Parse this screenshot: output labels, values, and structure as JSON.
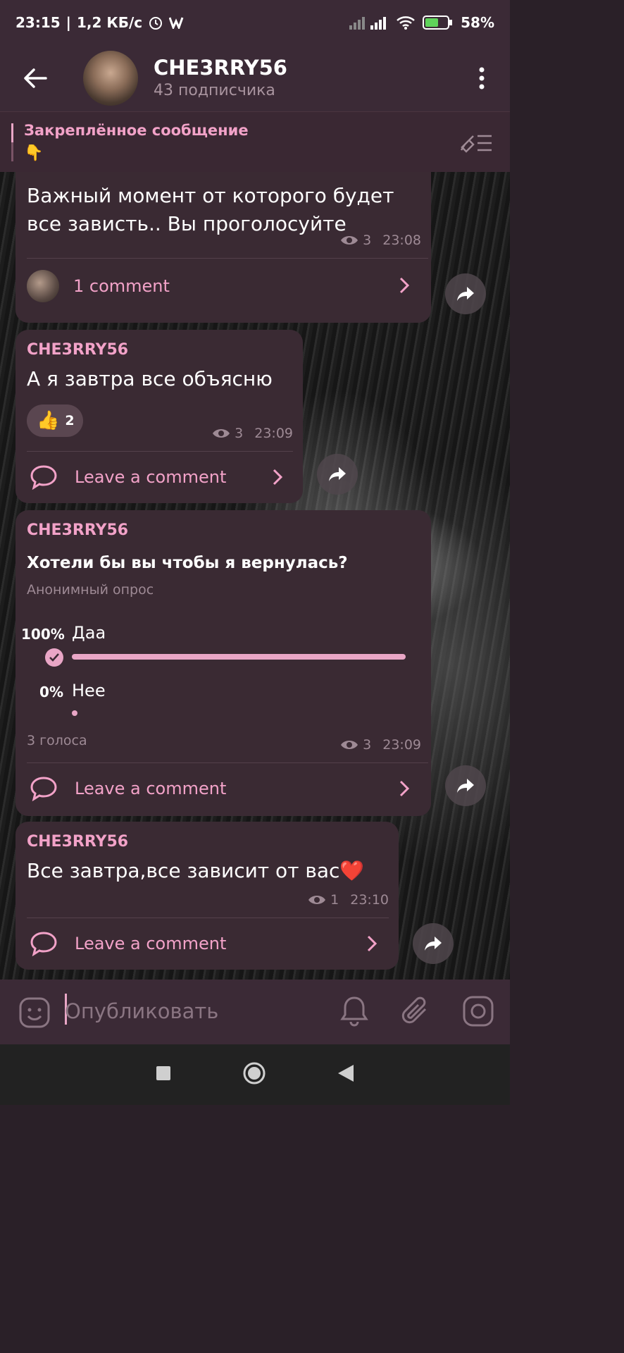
{
  "status": {
    "time": "23:15",
    "speed": "1,2 КБ/с",
    "battery": "58%"
  },
  "header": {
    "channel": "CHE3RRY56",
    "subscribers": "43 подписчика"
  },
  "pinned": {
    "title": "Закреплённое сообщение",
    "emoji": "👇"
  },
  "messages": [
    {
      "text": "Важный момент от которого будет все зависть.. Вы проголосуйте",
      "views": "3",
      "time": "23:08",
      "comment": "1 comment"
    },
    {
      "author": "CHE3RRY56",
      "text": "А я завтра все объясню",
      "reaction_emoji": "👍",
      "reaction_count": "2",
      "views": "3",
      "time": "23:09",
      "comment": "Leave a comment"
    },
    {
      "author": "CHE3RRY56",
      "poll_question": "Хотели бы вы чтобы я вернулась?",
      "poll_type": "Анонимный опрос",
      "options": [
        {
          "pct": "100%",
          "label": "Даа",
          "share": 1.0
        },
        {
          "pct": "0%",
          "label": "Нее",
          "share": 0.0
        }
      ],
      "votes": "3 голоса",
      "views": "3",
      "time": "23:09",
      "comment": "Leave a comment"
    },
    {
      "author": "CHE3RRY56",
      "text": "Все завтра,все зависит от вас❤️",
      "views": "1",
      "time": "23:10",
      "comment": "Leave a comment"
    }
  ],
  "composer": {
    "placeholder": "Опубликовать"
  },
  "colors": {
    "accent": "#e9a6c6",
    "bubble": "#3a2a33",
    "header": "#3b2a36"
  }
}
